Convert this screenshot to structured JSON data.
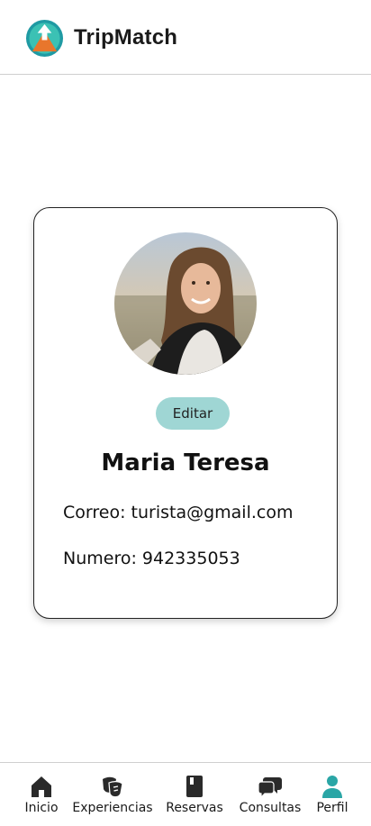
{
  "header": {
    "app_title": "TripMatch",
    "logo_icon": "mountain-logo-icon"
  },
  "profile": {
    "avatar_icon": "user-photo-avatar",
    "edit_label": "Editar",
    "name": "Maria Teresa",
    "email_line": "Correo: turista@gmail.com",
    "phone_line": "Numero: 942335053"
  },
  "nav": {
    "items": [
      {
        "label": "Inicio",
        "icon": "home-icon"
      },
      {
        "label": "Experiencias",
        "icon": "masks-icon"
      },
      {
        "label": "Reservas",
        "icon": "book-icon"
      },
      {
        "label": "Consultas",
        "icon": "chat-icon"
      },
      {
        "label": "Perfil",
        "icon": "person-icon"
      }
    ],
    "active": "Perfil"
  },
  "colors": {
    "accent": "#9fd6d4",
    "active_nav": "#2aa6a6",
    "logo_teal": "#2fb3a6",
    "logo_orange": "#e8762c"
  }
}
